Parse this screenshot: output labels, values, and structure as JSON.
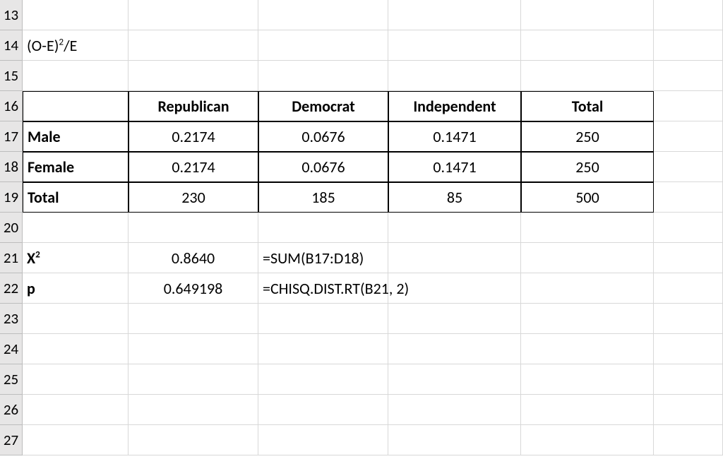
{
  "rows": [
    "13",
    "14",
    "15",
    "16",
    "17",
    "18",
    "19",
    "20",
    "21",
    "22",
    "23",
    "24",
    "25",
    "26",
    "27"
  ],
  "b14_plain": "(O-E)",
  "b14_sup": "2",
  "b14_tail": "/E",
  "headers": {
    "c2": "Republican",
    "c3": "Democrat",
    "c4": "Independent",
    "c5": "Total"
  },
  "tbl": {
    "r1": {
      "label": "Male",
      "v1": "0.2174",
      "v2": "0.0676",
      "v3": "0.1471",
      "v4": "250"
    },
    "r2": {
      "label": "Female",
      "v1": "0.2174",
      "v2": "0.0676",
      "v3": "0.1471",
      "v4": "250"
    },
    "r3": {
      "label": "Total",
      "v1": "230",
      "v2": "185",
      "v3": "85",
      "v4": "500"
    }
  },
  "x2": {
    "label_main": "X",
    "label_sup": "2",
    "value": "0.8640",
    "formula": "=SUM(B17:D18)"
  },
  "p": {
    "label": "p",
    "value": "0.649198",
    "formula": "=CHISQ.DIST.RT(B21, 2)"
  },
  "chart_data": {
    "type": "table",
    "title": "(O-E)^2/E",
    "columns": [
      "",
      "Republican",
      "Democrat",
      "Independent",
      "Total"
    ],
    "rows": [
      [
        "Male",
        0.2174,
        0.0676,
        0.1471,
        250
      ],
      [
        "Female",
        0.2174,
        0.0676,
        0.1471,
        250
      ],
      [
        "Total",
        230,
        185,
        85,
        500
      ]
    ],
    "stats": {
      "X2": 0.864,
      "p": 0.649198
    },
    "formulas": {
      "X2": "=SUM(B17:D18)",
      "p": "=CHISQ.DIST.RT(B21, 2)"
    }
  }
}
